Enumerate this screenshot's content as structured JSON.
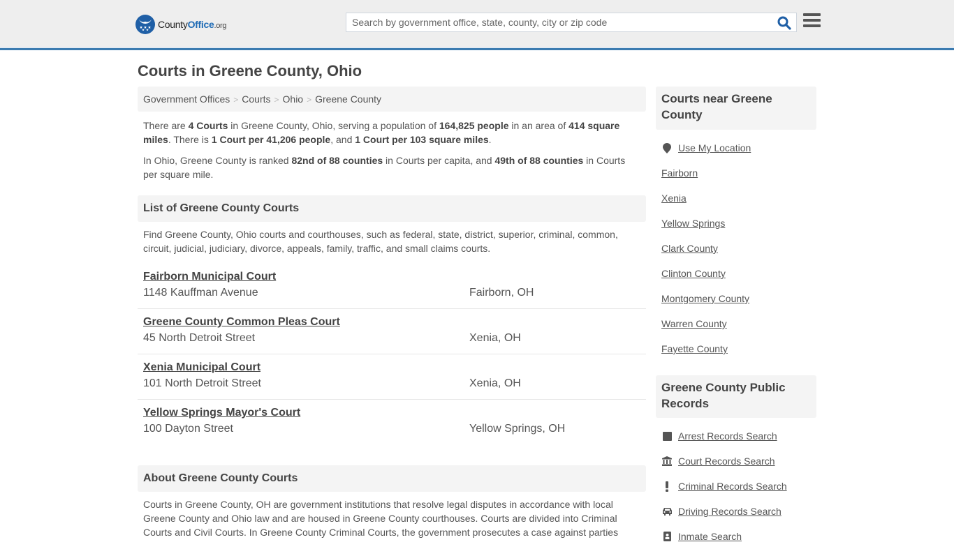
{
  "header": {
    "logo": {
      "brand_part1": "County",
      "brand_part2": "Office",
      "brand_suffix": ".org"
    },
    "search": {
      "placeholder": "Search by government office, state, county, city or zip code",
      "value": ""
    },
    "icons": {
      "search": "search-icon",
      "menu": "hamburger-menu-icon"
    }
  },
  "page": {
    "title": "Courts in Greene County, Ohio"
  },
  "breadcrumb": [
    {
      "label": "Government Offices"
    },
    {
      "label": "Courts"
    },
    {
      "label": "Ohio"
    },
    {
      "label": "Greene County"
    }
  ],
  "intro": {
    "p1": {
      "t1": "There are ",
      "b1": "4 Courts",
      "t2": " in Greene County, Ohio, serving a population of ",
      "b2": "164,825 people",
      "t3": " in an area of ",
      "b3": "414 square miles",
      "t4": ". There is ",
      "b4": "1 Court per 41,206 people",
      "t5": ", and ",
      "b5": "1 Court per 103 square miles",
      "t6": "."
    },
    "p2": {
      "t1": "In Ohio, Greene County is ranked ",
      "b1": "82nd of 88 counties",
      "t2": " in Courts per capita, and ",
      "b2": "49th of 88 counties",
      "t3": " in Courts per square mile."
    }
  },
  "list_section": {
    "heading": "List of Greene County Courts",
    "description": "Find Greene County, Ohio courts and courthouses, such as federal, state, district, superior, criminal, common, circuit, judicial, judiciary, divorce, appeals, family, traffic, and small claims courts.",
    "courts": [
      {
        "name": "Fairborn Municipal Court",
        "address": "1148 Kauffman Avenue",
        "city": "Fairborn, OH"
      },
      {
        "name": "Greene County Common Pleas Court",
        "address": "45 North Detroit Street",
        "city": "Xenia, OH"
      },
      {
        "name": "Xenia Municipal Court",
        "address": "101 North Detroit Street",
        "city": "Xenia, OH"
      },
      {
        "name": "Yellow Springs Mayor's Court",
        "address": "100 Dayton Street",
        "city": "Yellow Springs, OH"
      }
    ]
  },
  "about_section": {
    "heading": "About Greene County Courts",
    "text": "Courts in Greene County, OH are government institutions that resolve legal disputes in accordance with local Greene County and Ohio law and are housed in Greene County courthouses. Courts are divided into Criminal Courts and Civil Courts. In Greene County Criminal Courts, the government prosecutes a case against parties"
  },
  "sidebar": {
    "nearby": {
      "heading": "Courts near Greene County",
      "use_location": {
        "label": "Use My Location",
        "icon": "map-marker-icon"
      },
      "links": [
        "Fairborn",
        "Xenia",
        "Yellow Springs",
        "Clark County",
        "Clinton County",
        "Montgomery County",
        "Warren County",
        "Fayette County"
      ]
    },
    "records": {
      "heading": "Greene County Public Records",
      "links": [
        {
          "label": "Arrest Records Search",
          "icon": "square-icon"
        },
        {
          "label": "Court Records Search",
          "icon": "courthouse-icon"
        },
        {
          "label": "Criminal Records Search",
          "icon": "exclamation-icon"
        },
        {
          "label": "Driving Records Search",
          "icon": "car-icon"
        },
        {
          "label": "Inmate Search",
          "icon": "id-badge-icon"
        }
      ]
    }
  },
  "colors": {
    "accent": "#3b7bb0",
    "brand_blue": "#1f5fa6",
    "search_icon": "#1f5fa6",
    "text": "#555555",
    "panel_bg": "#f4f4f4"
  }
}
